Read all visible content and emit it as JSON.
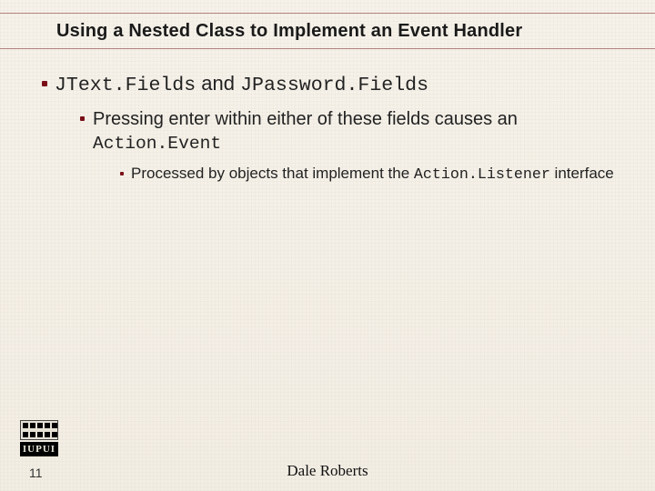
{
  "title": "Using a Nested Class to Implement an Event Handler",
  "bullets": {
    "lvl1": {
      "code1": "JText.Fields",
      "mid": " and ",
      "code2": "JPassword.Fields"
    },
    "lvl2": {
      "pre": "Pressing enter within either of these fields causes an ",
      "code": "Action.Event"
    },
    "lvl3": {
      "pre": "Processed by objects that implement the ",
      "code": "Action.Listener",
      "post": " interface"
    }
  },
  "footer": {
    "author": "Dale Roberts",
    "page": "11",
    "logo_text": "IUPUI"
  }
}
